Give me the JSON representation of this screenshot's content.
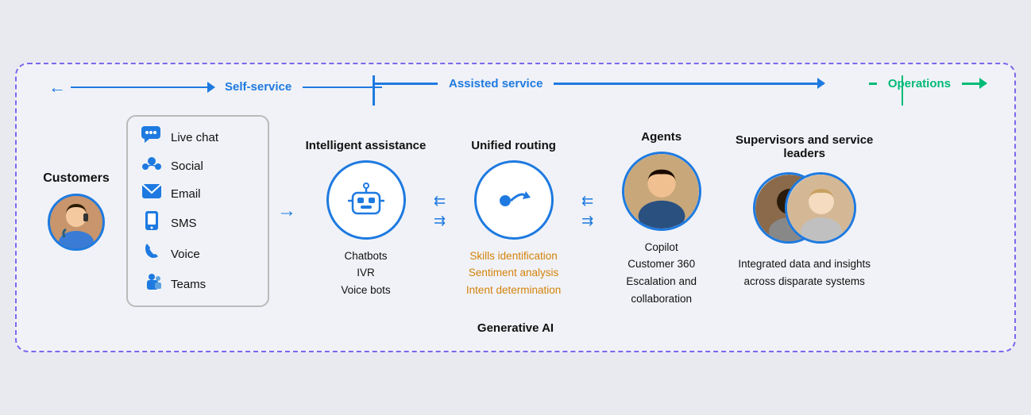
{
  "diagram": {
    "border_color": "#7b68ee",
    "top_arrows": [
      {
        "label": "Self-service",
        "color": "#1e7ae0",
        "direction": "left-to-right"
      },
      {
        "label": "Assisted service",
        "color": "#1e7ae0",
        "direction": "left-to-right"
      },
      {
        "label": "Operations",
        "color": "#00bb77",
        "direction": "left-to-right"
      }
    ],
    "customers": {
      "label": "Customers"
    },
    "channels": {
      "items": [
        {
          "name": "Live chat",
          "icon": "chat"
        },
        {
          "name": "Social",
          "icon": "social"
        },
        {
          "name": "Email",
          "icon": "email"
        },
        {
          "name": "SMS",
          "icon": "sms"
        },
        {
          "name": "Voice",
          "icon": "voice"
        },
        {
          "name": "Teams",
          "icon": "teams"
        }
      ]
    },
    "stages": [
      {
        "title": "Intelligent assistance",
        "icon": "robot",
        "items": [
          "Chatbots",
          "IVR",
          "Voice bots"
        ],
        "highlighted": []
      },
      {
        "title": "Unified routing",
        "icon": "routing",
        "items": [
          "Skills identification",
          "Sentiment analysis",
          "Intent determination"
        ],
        "highlighted": [
          "Skills identification",
          "Sentiment analysis",
          "Intent determination"
        ]
      },
      {
        "title": "Agents",
        "icon": "agent-photo",
        "items": [
          "Copilot",
          "Customer 360",
          "Escalation and collaboration"
        ],
        "highlighted": []
      },
      {
        "title": "Supervisors and service leaders",
        "icon": "supervisors-photo",
        "items": [
          "Integrated data and insights across disparate systems"
        ],
        "highlighted": []
      }
    ],
    "bottom_label": "Generative AI"
  }
}
